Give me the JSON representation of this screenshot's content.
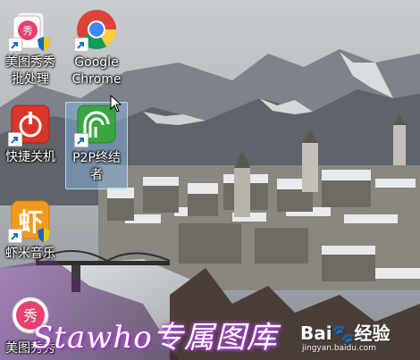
{
  "desktop": {
    "icons": [
      {
        "label": "美图秀秀\n批处理",
        "icon": "meitu-batch-icon"
      },
      {
        "label": "Google\nChrome",
        "icon": "chrome-icon"
      },
      {
        "label": "快捷关机",
        "icon": "power-icon"
      },
      {
        "label": "P2P终结\n者",
        "icon": "p2p-icon",
        "selected": true
      },
      {
        "label": "虾米音乐",
        "icon": "xiami-icon"
      },
      {
        "label": "美图秀秀",
        "icon": "meitu-icon"
      }
    ]
  },
  "watermark": {
    "text": "Stawho专属图库",
    "brand": "Bai🐾经验",
    "url": "jingyan.baidu.com"
  },
  "colors": {
    "selection": "#8cbef0",
    "watermark_glow": "#b04cd0"
  }
}
